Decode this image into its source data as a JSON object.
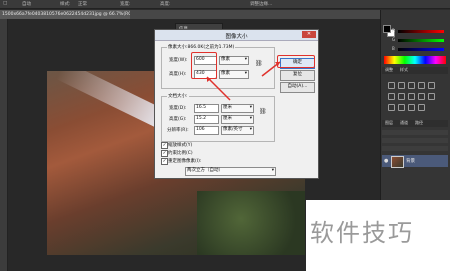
{
  "optbar": [
    "□",
    "自动",
    "样式:",
    "正常",
    "宽度:",
    "高度:",
    "调整边缘..."
  ],
  "tabs": {
    "document": "1500x66a7fe0403810576e0622454d231jpg @ 66.7%(RGB/8) ✕"
  },
  "floating_panel": {
    "label": "信息"
  },
  "color_panel": {
    "r": "R",
    "g": "G",
    "b": "B",
    "fg": "#000000",
    "bg": "#ffffff"
  },
  "adjust_tabs": [
    "调整",
    "样式"
  ],
  "layers_tabs": [
    "图层",
    "通道",
    "路径"
  ],
  "layer": {
    "name": "背景"
  },
  "dialog": {
    "title": "图像大小",
    "close": "✕",
    "pixel_group_title": "像素大小:866.0K(之前为1.73M)",
    "width_label": "宽度(W):",
    "width_value": "600",
    "width_unit": "像素",
    "height_label": "高度(H):",
    "height_value": "430",
    "height_unit": "像素",
    "doc_group_title": "文档大小:",
    "doc_width_label": "宽度(D):",
    "doc_width_value": "16.5",
    "doc_width_unit": "厘米",
    "doc_height_label": "高度(G):",
    "doc_height_value": "15.2",
    "doc_height_unit": "厘米",
    "res_label": "分辨率(R):",
    "res_value": "106",
    "res_unit": "像素/英寸",
    "ok": "确定",
    "cancel": "复位",
    "auto": "自动(A)...",
    "scale_styles": "缩放样式(Y)",
    "constrain": "约束比例(C)",
    "resample": "重定图像像素(I):",
    "resample_method": "两次立方（自动）",
    "check_mark": "✓"
  },
  "watermark": "软件技巧"
}
